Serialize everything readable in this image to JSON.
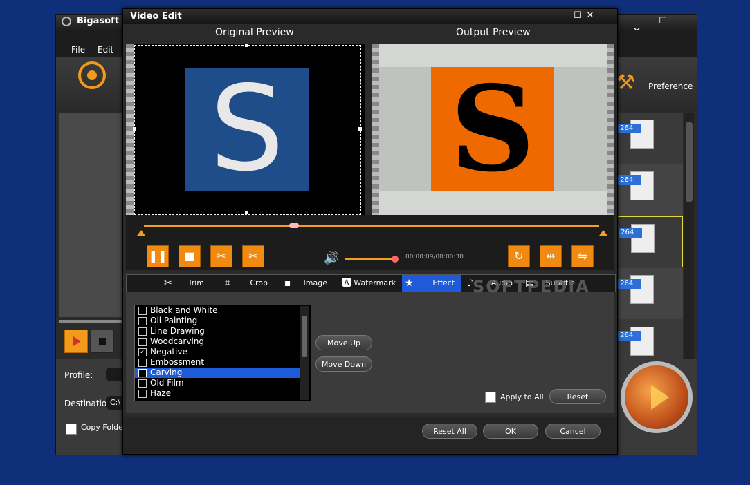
{
  "main": {
    "title": "Bigasoft To",
    "menu": [
      "File",
      "Edit"
    ],
    "preference_label": "Preference",
    "profile_label": "Profile:",
    "destination_label": "Destination:",
    "destination_value": "C:\\",
    "copy_folder_label": "Copy Folder",
    "file_badges": [
      ".264",
      ".264",
      ".264",
      ".264",
      ".264"
    ]
  },
  "dialog": {
    "title": "Video Edit",
    "original_preview": "Original Preview",
    "output_preview": "Output Preview",
    "sample_letter": "S",
    "time": "00:00:09/00:00:30",
    "tabs": [
      {
        "label": "Trim",
        "icon": "scissors-icon"
      },
      {
        "label": "Crop",
        "icon": "crop-icon"
      },
      {
        "label": "Image",
        "icon": "image-icon"
      },
      {
        "label": "Watermark",
        "icon": "watermark-icon"
      },
      {
        "label": "Effect",
        "icon": "star-icon"
      },
      {
        "label": "Audio",
        "icon": "music-icon"
      },
      {
        "label": "Subtitle",
        "icon": "subtitle-icon"
      }
    ],
    "active_tab": "Effect",
    "effects": [
      {
        "label": "Black and White",
        "checked": false
      },
      {
        "label": "Oil Painting",
        "checked": false
      },
      {
        "label": "Line Drawing",
        "checked": false
      },
      {
        "label": "Woodcarving",
        "checked": false
      },
      {
        "label": "Negative",
        "checked": true
      },
      {
        "label": "Embossment",
        "checked": false
      },
      {
        "label": "Carving",
        "checked": false
      },
      {
        "label": "Old Film",
        "checked": false
      },
      {
        "label": "Haze",
        "checked": false
      }
    ],
    "selected_effect": "Carving",
    "move_up": "Move Up",
    "move_down": "Move Down",
    "apply_to_all": "Apply to All",
    "reset": "Reset",
    "reset_all": "Reset All",
    "ok": "OK",
    "cancel": "Cancel",
    "watermark_text": "SOFTPEDIA"
  }
}
